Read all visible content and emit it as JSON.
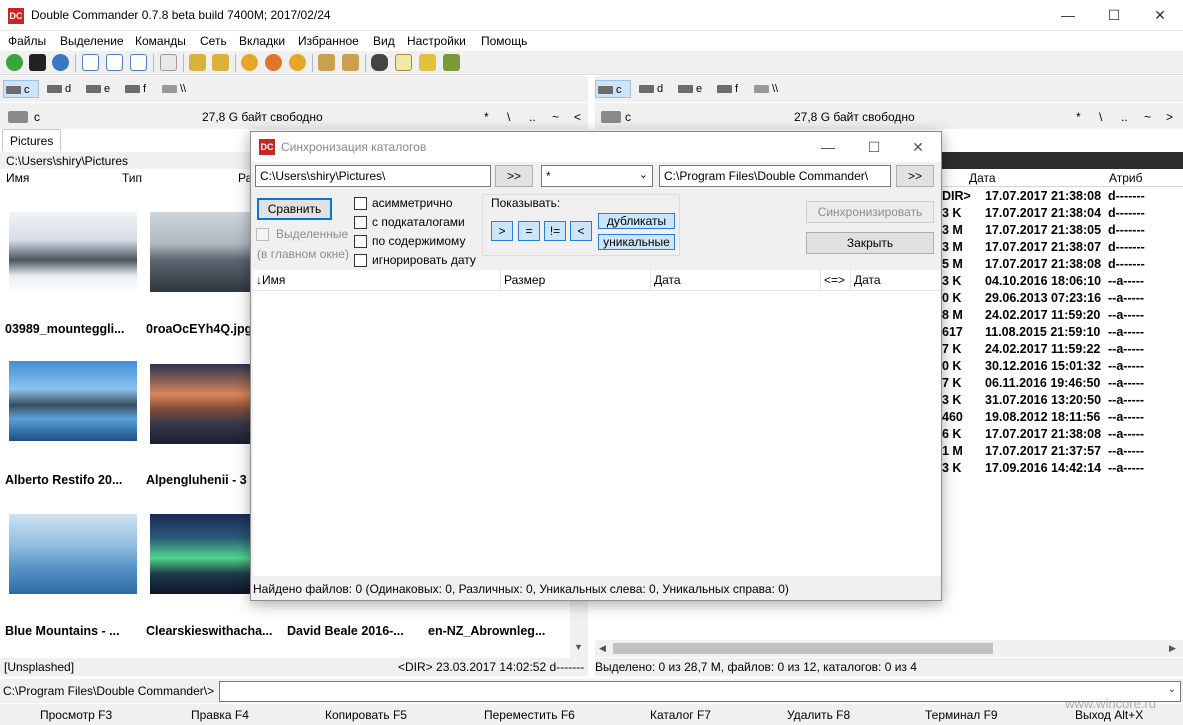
{
  "window": {
    "title": "Double Commander 0.7.8 beta build 7400M; 2017/02/24",
    "logo": "DC"
  },
  "menu": [
    "Файлы",
    "Выделение",
    "Команды",
    "Сеть",
    "Вкладки",
    "Избранное",
    "Вид",
    "Настройки",
    "Помощь"
  ],
  "toolbar_icons": [
    "refresh-icon",
    "terminal-icon",
    "options-icon",
    "brief-view-icon",
    "full-view-icon",
    "thumbnail-view-icon",
    "flat-view-icon",
    "go-back-icon",
    "go-forward-icon",
    "copy-files-icon",
    "move-files-icon",
    "delete-files-icon",
    "pack-icon",
    "unpack-icon",
    "search-icon",
    "multi-rename-icon",
    "sync-dirs-icon",
    "compare-icon"
  ],
  "left": {
    "drives": [
      "c",
      "d",
      "e",
      "f",
      "\\\\"
    ],
    "active_drive": "c",
    "drive_label": "c",
    "free_space": "27,8 G байт свободно",
    "nav_buttons": [
      "*",
      "\\",
      "..",
      "~",
      "<"
    ],
    "tab": "Pictures",
    "path": "C:\\Users\\shiry\\Pictures",
    "columns": [
      "Имя",
      "Тип",
      "Ра"
    ],
    "thumbs": [
      {
        "label": "03989_mounteggli...",
        "icon": "photo-snowy-forest-icon"
      },
      {
        "label": "0roaOcEYh4Q.jpg",
        "icon": "photo-mountain-dusk-icon"
      },
      {
        "label": "Alberto Restifo  20...",
        "icon": "photo-lake-mountains-icon"
      },
      {
        "label": "Alpengluhenii - 3",
        "icon": "photo-alpenglow-icon"
      },
      {
        "label": "Blue Mountains - ...",
        "icon": "photo-blue-mountains-icon"
      },
      {
        "label": "Clearskieswithacha...",
        "icon": "photo-aurora-icon"
      },
      {
        "label": "David Beale  2016-...",
        "icon": ""
      },
      {
        "label": "en-NZ_Abrownleg...",
        "icon": ""
      }
    ],
    "status_name": "[Unsplashed]",
    "status_info": "<DIR>  23.03.2017 14:02:52  d-------"
  },
  "right": {
    "drives": [
      "c",
      "d",
      "e",
      "f",
      "\\\\"
    ],
    "active_drive": "c",
    "drive_label": "c",
    "free_space": "27,8 G байт свободно",
    "nav_buttons": [
      "*",
      "\\",
      "..",
      "~",
      ">"
    ],
    "columns": [
      "Дата",
      "Атриб"
    ],
    "rows": [
      {
        "size": "DIR>",
        "date": "17.07.2017 21:38:08",
        "attr": "d-------"
      },
      {
        "size": "3 K",
        "date": "17.07.2017 21:38:04",
        "attr": "d-------"
      },
      {
        "size": "3 M",
        "date": "17.07.2017 21:38:05",
        "attr": "d-------"
      },
      {
        "size": "3 M",
        "date": "17.07.2017 21:38:07",
        "attr": "d-------"
      },
      {
        "size": "5 M",
        "date": "17.07.2017 21:38:08",
        "attr": "d-------"
      },
      {
        "size": "3 K",
        "date": "04.10.2016 18:06:10",
        "attr": "--a-----"
      },
      {
        "size": "0 K",
        "date": "29.06.2013 07:23:16",
        "attr": "--a-----"
      },
      {
        "size": "8 M",
        "date": "24.02.2017 11:59:20",
        "attr": "--a-----"
      },
      {
        "size": "617",
        "date": "11.08.2015 21:59:10",
        "attr": "--a-----"
      },
      {
        "size": "7 K",
        "date": "24.02.2017 11:59:22",
        "attr": "--a-----"
      },
      {
        "size": "0 K",
        "date": "30.12.2016 15:01:32",
        "attr": "--a-----"
      },
      {
        "size": "7 K",
        "date": "06.11.2016 19:46:50",
        "attr": "--a-----"
      },
      {
        "size": "3 K",
        "date": "31.07.2016 13:20:50",
        "attr": "--a-----"
      },
      {
        "size": "460",
        "date": "19.08.2012 18:11:56",
        "attr": "--a-----"
      },
      {
        "size": "6 K",
        "date": "17.07.2017 21:38:08",
        "attr": "--a-----"
      },
      {
        "size": "1 M",
        "date": "17.07.2017 21:37:57",
        "attr": "--a-----"
      },
      {
        "size": "3 K",
        "date": "17.09.2016 14:42:14",
        "attr": "--a-----"
      }
    ],
    "status": "Выделено: 0 из 28,7 M, файлов: 0 из 12, каталогов: 0 из 4"
  },
  "cmdline": {
    "path": "C:\\Program Files\\Double Commander\\>",
    "value": ""
  },
  "fkeys": [
    "Просмотр F3",
    "Правка F4",
    "Копировать F5",
    "Переместить F6",
    "Каталог F7",
    "Удалить F8",
    "Терминал F9",
    "Выход Alt+X"
  ],
  "watermark": "www.wincore.ru",
  "dialog": {
    "title": "Синхронизация каталогов",
    "left_path": "C:\\Users\\shiry\\Pictures\\",
    "browse_label": ">>",
    "mask": "*",
    "right_path": "C:\\Program Files\\Double Commander\\",
    "compare_btn": "Сравнить",
    "selected_chk": "Выделенные",
    "selected_note": "(в главном окне)",
    "options": [
      "асимметрично",
      "с подкаталогами",
      "по содержимому",
      "игнорировать дату"
    ],
    "show_label": "Показывать:",
    "show_buttons": [
      ">",
      "=",
      "!=",
      "<"
    ],
    "toggle_dup": "дубликаты",
    "toggle_uniq": "уникальные",
    "sync_btn": "Синхронизировать",
    "close_btn": "Закрыть",
    "columns": [
      "↓Имя",
      "Размер",
      "Дата",
      "<=>",
      "Дата"
    ],
    "status": "Найдено файлов: 0  (Одинаковых: 0, Различных: 0, Уникальных слева: 0, Уникальных справа: 0)"
  }
}
